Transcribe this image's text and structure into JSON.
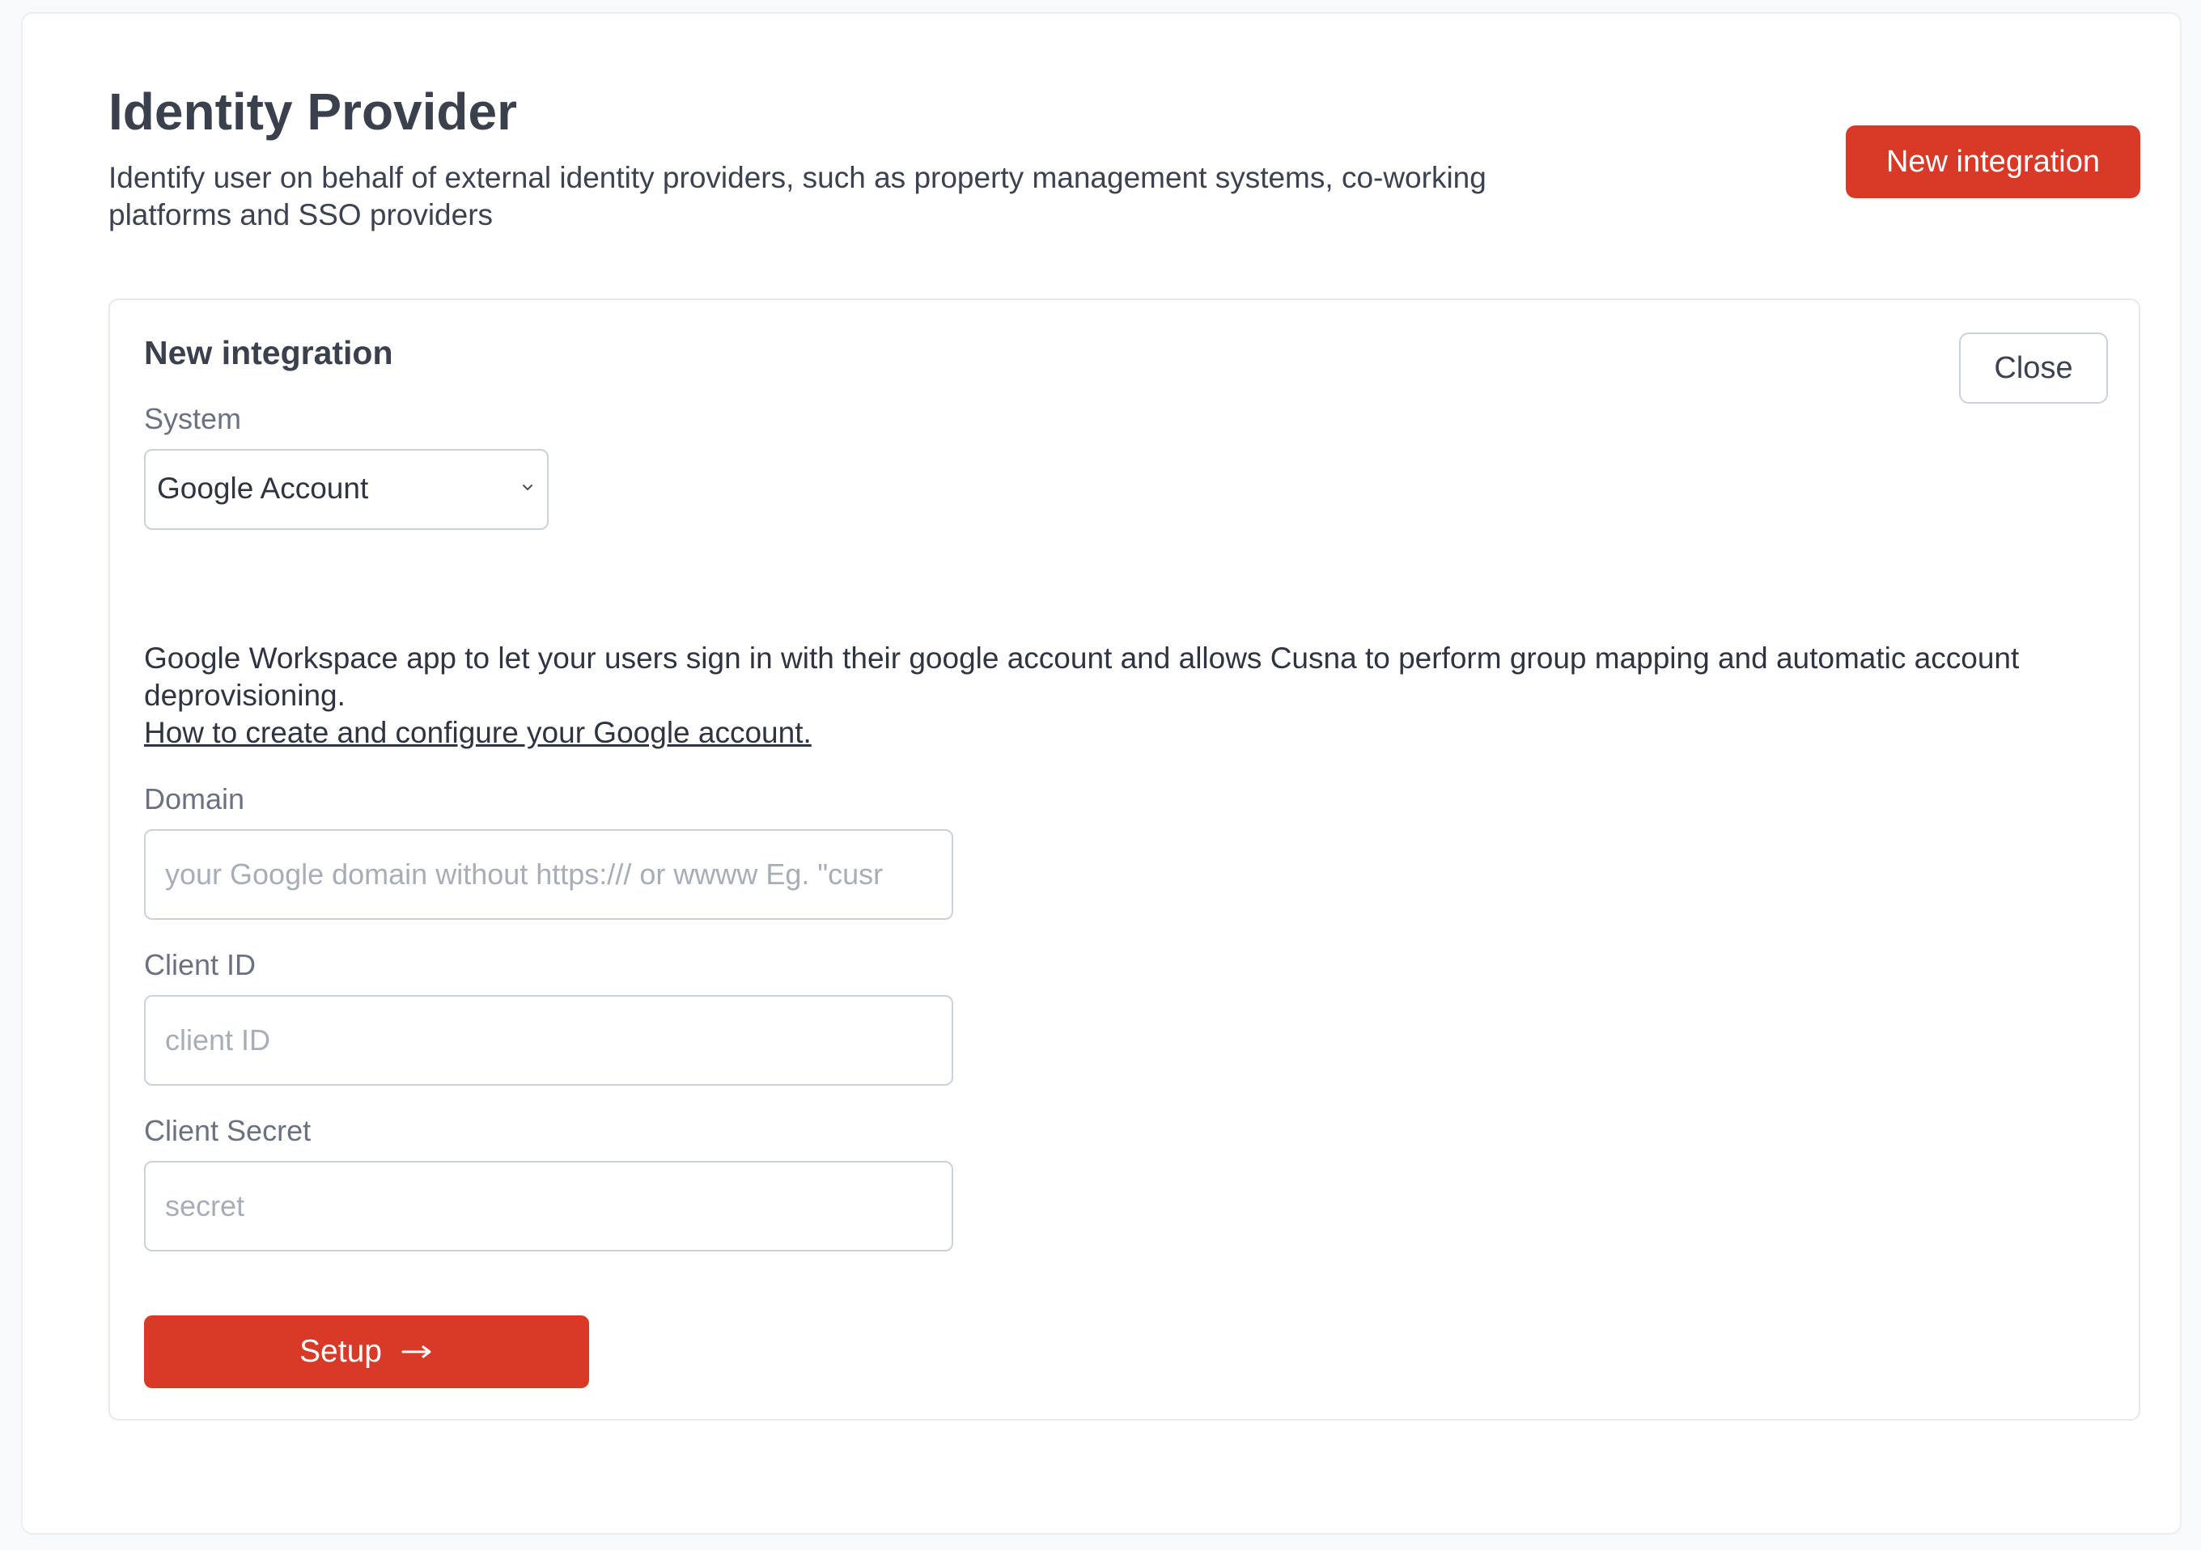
{
  "header": {
    "title": "Identity Provider",
    "description": "Identify user on behalf of external identity providers, such as property management systems, co-working platforms and SSO providers",
    "new_integration_label": "New integration"
  },
  "panel": {
    "title": "New integration",
    "close_label": "Close",
    "system": {
      "label": "System",
      "selected": "Google Account",
      "icon": "chevron-down-icon"
    },
    "info": {
      "text": "Google Workspace app to let your users sign in with their google account and allows Cusna to perform group mapping and automatic account deprovisioning.",
      "link": "How to create and configure your Google account."
    },
    "domain": {
      "label": "Domain",
      "value": "",
      "placeholder": "your Google domain without https:/// or wwww Eg. \"cusr"
    },
    "client_id": {
      "label": "Client ID",
      "value": "",
      "placeholder": "client ID"
    },
    "client_secret": {
      "label": "Client Secret",
      "value": "",
      "placeholder": "secret"
    },
    "setup_label": "Setup",
    "setup_icon": "arrow-right-icon"
  },
  "colors": {
    "accent": "#d93a28",
    "text": "#3d4250",
    "muted": "#6b7180",
    "border": "#cdd1d8"
  }
}
